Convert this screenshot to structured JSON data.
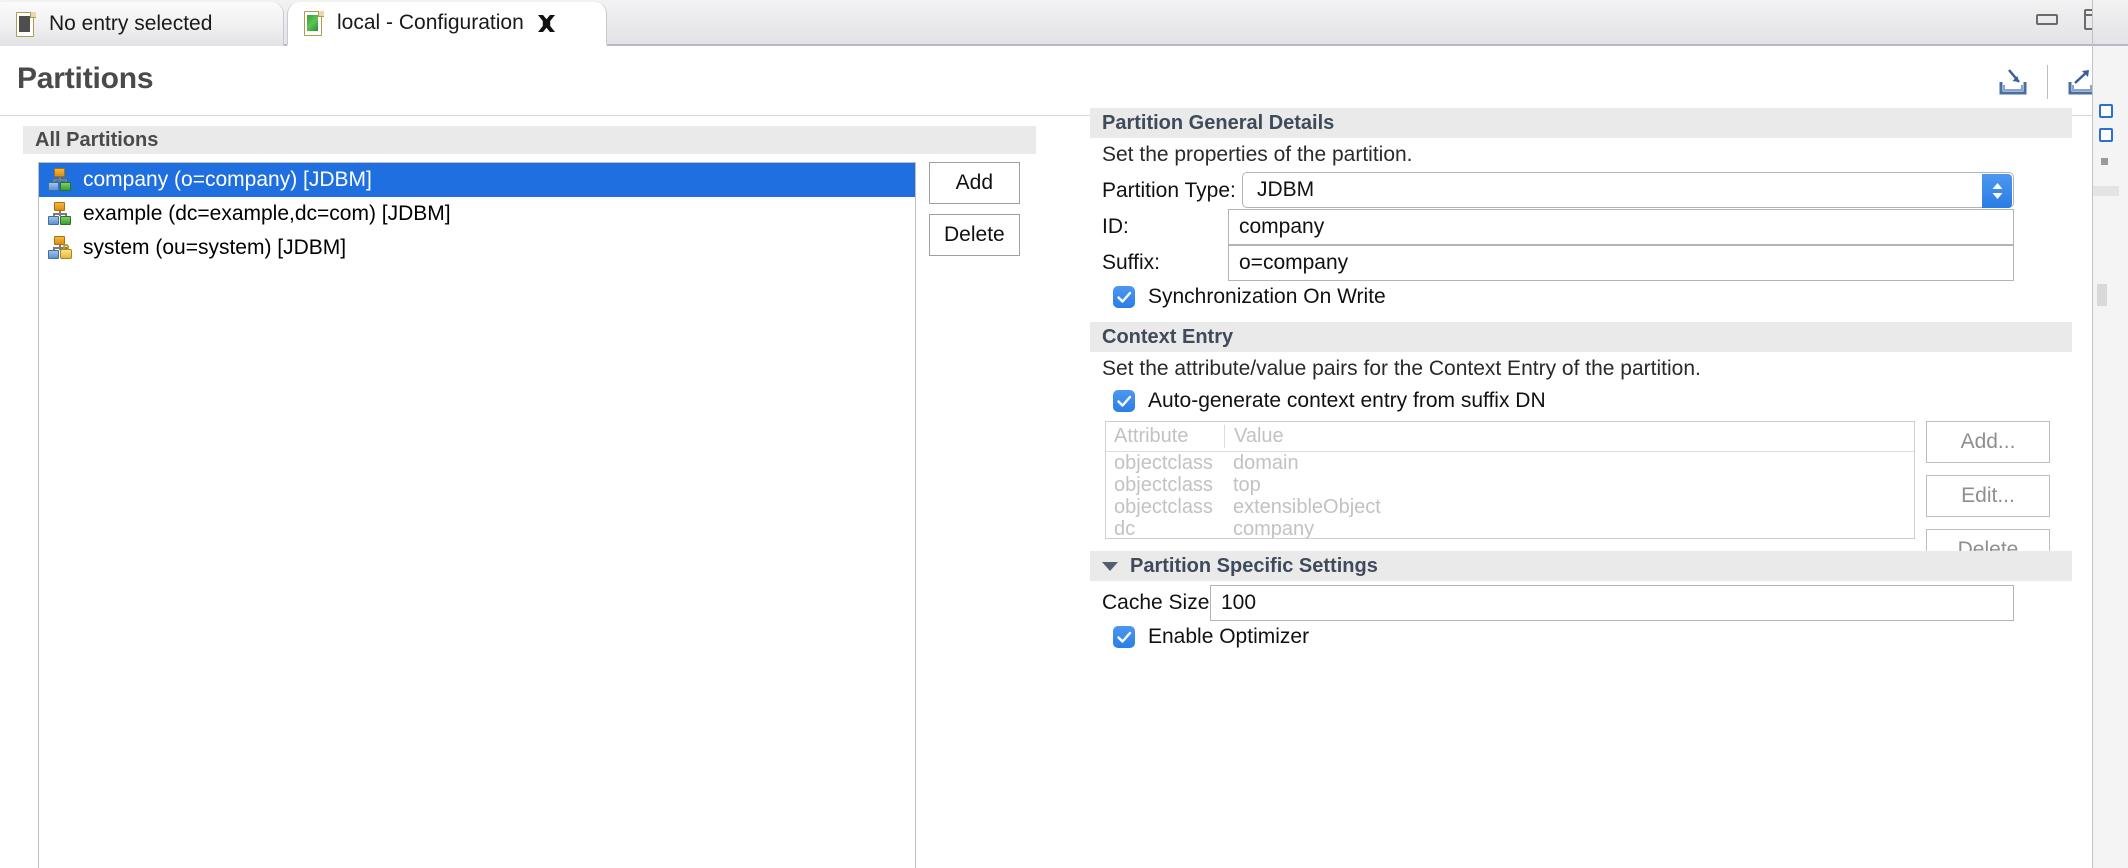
{
  "window": {
    "minimize_label": "Minimize",
    "maximize_label": "Restore"
  },
  "tabs": [
    {
      "label": "No entry selected",
      "icon": "document-icon",
      "active": false,
      "closable": false
    },
    {
      "label": "local - Configuration",
      "icon": "document-green-icon",
      "active": true,
      "closable": true
    }
  ],
  "header": {
    "title": "Partitions",
    "import_icon": "import-icon",
    "export_icon": "export-icon"
  },
  "left": {
    "section_title": "All Partitions",
    "partitions": [
      {
        "label": "company (o=company) [JDBM]",
        "icon": "partition-icon",
        "selected": true
      },
      {
        "label": "example (dc=example,dc=com) [JDBM]",
        "icon": "partition-icon",
        "selected": false
      },
      {
        "label": "system (ou=system) [JDBM]",
        "icon": "partition-system-icon",
        "selected": false
      }
    ],
    "add_label": "Add",
    "delete_label": "Delete"
  },
  "general": {
    "section_title": "Partition General Details",
    "description": "Set the properties of the partition.",
    "partition_type_label": "Partition Type:",
    "partition_type_value": "JDBM",
    "id_label": "ID:",
    "id_value": "company",
    "suffix_label": "Suffix:",
    "suffix_value": "o=company",
    "sync_on_write_label": "Synchronization On Write",
    "sync_on_write_checked": true
  },
  "context_entry": {
    "section_title": "Context Entry",
    "description": "Set the attribute/value pairs for the Context Entry of the partition.",
    "auto_generate_label": "Auto-generate context entry from suffix DN",
    "auto_generate_checked": true,
    "table": {
      "columns": [
        "Attribute",
        "Value",
        ""
      ],
      "rows": [
        {
          "attribute": "objectclass",
          "value": "domain"
        },
        {
          "attribute": "objectclass",
          "value": "top"
        },
        {
          "attribute": "objectclass",
          "value": "extensibleObject"
        },
        {
          "attribute": "dc",
          "value": "company"
        }
      ]
    },
    "add_label": "Add...",
    "edit_label": "Edit...",
    "delete_label": "Delete"
  },
  "specific": {
    "section_title": "Partition Specific Settings",
    "expanded": true,
    "cache_size_label": "Cache Size:",
    "cache_size_value": "100",
    "enable_optimizer_label": "Enable Optimizer",
    "enable_optimizer_checked": true
  },
  "colors": {
    "selection_blue": "#1f6fe0",
    "control_blue": "#2b7ee5",
    "section_gray": "#eaeaea",
    "disabled_gray": "#c2c2c2",
    "title_gray": "#4a4a4a"
  }
}
